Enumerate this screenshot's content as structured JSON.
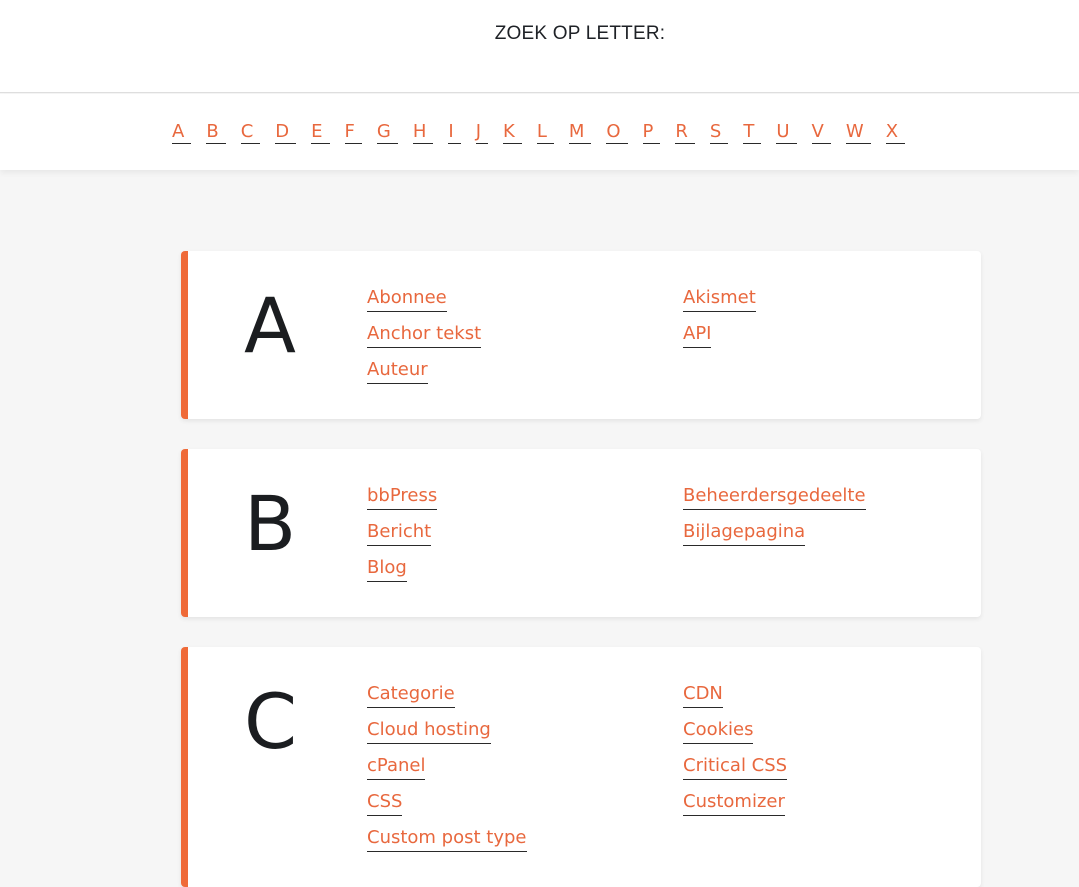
{
  "header": {
    "title": "ZOEK OP LETTER:"
  },
  "letter_nav": [
    "A",
    "B",
    "C",
    "D",
    "E",
    "F",
    "G",
    "H",
    "I",
    "J",
    "K",
    "L",
    "M",
    "O",
    "P",
    "R",
    "S",
    "T",
    "U",
    "V",
    "W",
    "X"
  ],
  "sections": [
    {
      "letter": "A",
      "left": [
        "Abonnee",
        "Anchor tekst",
        "Auteur"
      ],
      "right": [
        "Akismet",
        "API"
      ]
    },
    {
      "letter": "B",
      "left": [
        "bbPress",
        "Bericht",
        "Blog"
      ],
      "right": [
        "Beheerdersgedeelte",
        "Bijlagepagina"
      ]
    },
    {
      "letter": "C",
      "left": [
        "Categorie",
        "Cloud hosting",
        "cPanel",
        "CSS",
        "Custom post type"
      ],
      "right": [
        "CDN",
        "Cookies",
        "Critical CSS",
        "Customizer"
      ]
    }
  ],
  "colors": {
    "accent": "#e8683e",
    "card_border": "#ef6a38",
    "background": "#f6f6f6",
    "heading_text": "#1b1d20"
  }
}
